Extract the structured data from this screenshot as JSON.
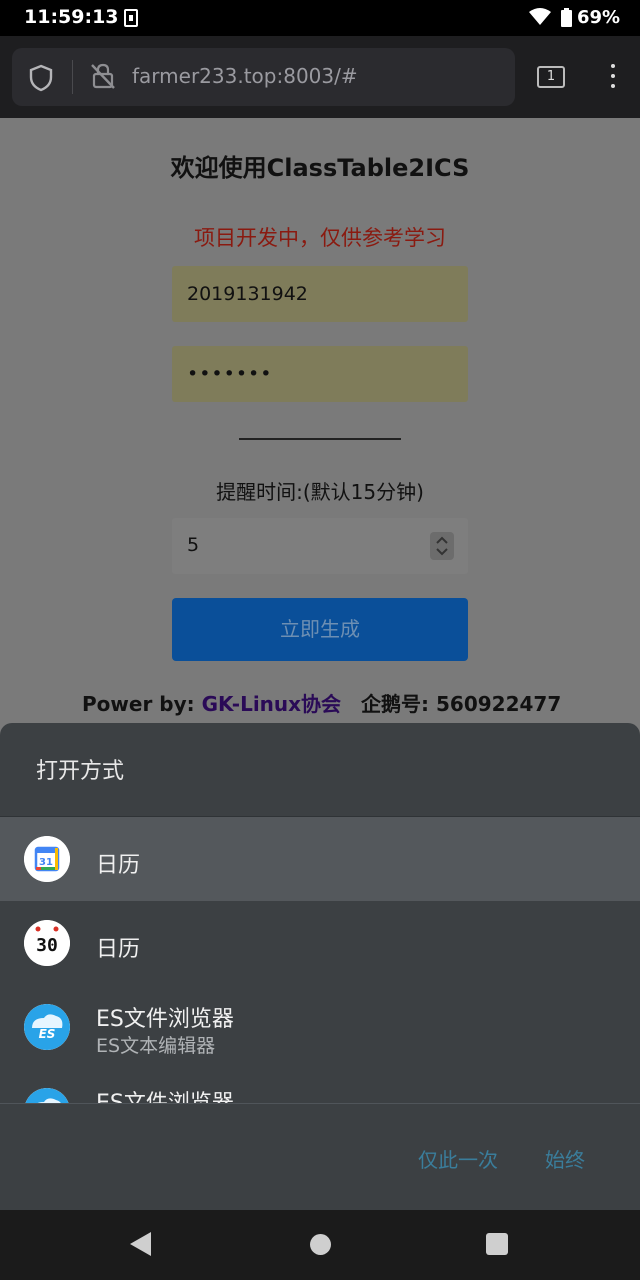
{
  "status_bar": {
    "time": "11:59:13",
    "battery": "69%"
  },
  "browser": {
    "url": "farmer233.top:8003/#",
    "tab_count": "1"
  },
  "page": {
    "title": "欢迎使用ClassTable2ICS",
    "notice": "项目开发中，仅供参考学习",
    "username_value": "2019131942",
    "password_value": "•••••••",
    "remind_label": "提醒时间:(默认15分钟)",
    "remind_value": "5",
    "generate_label": "立即生成",
    "power_prefix": "Power by: ",
    "power_link": "GK-Linux协会",
    "qq_group": "企鹅号: 560922477"
  },
  "sheet": {
    "title": "打开方式",
    "apps": [
      {
        "label": "日历",
        "icon": "google-calendar-icon",
        "badge": "31"
      },
      {
        "label": "日历",
        "icon": "calendar-icon",
        "badge": "30"
      },
      {
        "label": "ES文件浏览器",
        "sub": "ES文本编辑器",
        "icon": "es-file-explorer-icon"
      },
      {
        "label": "ES文件浏览器",
        "icon": "es-file-explorer-icon"
      }
    ],
    "btn_once": "仅此一次",
    "btn_always": "始终"
  },
  "colors": {
    "primary_button": "#0a4f99",
    "link": "#2a0a57",
    "notice": "#8a1a10",
    "sheet_bg": "#3c4043",
    "sheet_accent": "#3a7d9b"
  }
}
